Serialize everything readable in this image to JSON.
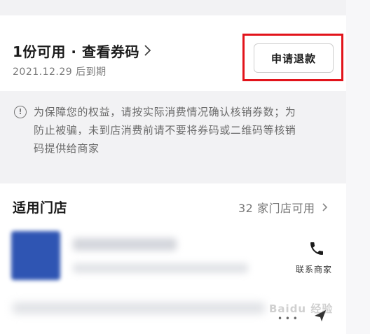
{
  "voucher": {
    "title": "1份可用 · 查看券码",
    "expiry": "2021.12.29 后到期",
    "refund_label": "申请退款"
  },
  "notice": {
    "lines": [
      "为保障您的权益，请按实际消费情况确认核销券数；为",
      "防止被骗，未到店消费前请不要将券码或二维码等核销",
      "码提供给商家"
    ]
  },
  "stores": {
    "title": "适用门店",
    "count_label": "32 家门店可用",
    "contact_label": "联系商家"
  },
  "watermark": "Baidu 经验",
  "colors": {
    "highlight": "#e2141b",
    "thumb": "#2f55b3"
  },
  "icons": [
    "chevron-right-icon",
    "info-icon",
    "phone-icon",
    "share-icon"
  ]
}
